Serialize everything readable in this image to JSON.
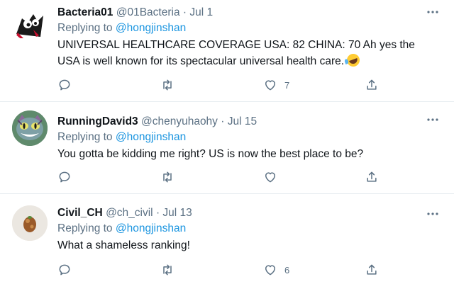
{
  "tweets": [
    {
      "display_name": "Bacteria01",
      "handle": "@01Bacteria",
      "separator": "·",
      "date": "Jul 1",
      "replying_prefix": "Replying to",
      "replying_to": "@hongjinshan",
      "text": "UNIVERSAL HEALTHCARE COVERAGE USA: 82 CHINA: 70 Ah yes the USA is well known for its spectacular universal health care.",
      "emoji": "rolling-on-the-floor-laughing-emoji",
      "like_count": "7"
    },
    {
      "display_name": "RunningDavid3",
      "handle": "@chenyuhaohy",
      "separator": "·",
      "date": "Jul 15",
      "replying_prefix": "Replying to",
      "replying_to": "@hongjinshan",
      "text": "You gotta be kidding me right? US is now the best place to be?",
      "like_count": ""
    },
    {
      "display_name": "Civil_CH",
      "handle": "@ch_civil",
      "separator": "·",
      "date": "Jul 13",
      "replying_prefix": "Replying to",
      "replying_to": "@hongjinshan",
      "text": "What a shameless ranking!",
      "like_count": "6"
    }
  ],
  "icons": {
    "more": "more-dots-icon",
    "reply": "reply-bubble-icon",
    "retweet": "retweet-icon",
    "like": "heart-icon",
    "share": "share-icon"
  },
  "colors": {
    "text": "#0f1419",
    "secondary": "#5b7083",
    "mention": "#1b95e0",
    "divider": "#e6ecf0"
  }
}
